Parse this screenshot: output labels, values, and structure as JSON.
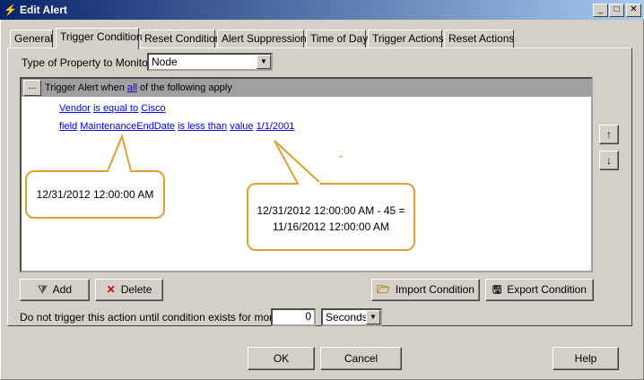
{
  "window": {
    "title": "Edit Alert",
    "min_glyph": "_",
    "max_glyph": "□",
    "close_glyph": "✕"
  },
  "tabs": [
    {
      "label": "General"
    },
    {
      "label": "Trigger Condition"
    },
    {
      "label": "Reset Condition"
    },
    {
      "label": "Alert Suppression"
    },
    {
      "label": "Time of Day"
    },
    {
      "label": "Trigger Actions"
    },
    {
      "label": "Reset Actions"
    }
  ],
  "active_tab": "Trigger Condition",
  "property": {
    "label": "Type of Property to Monitor:",
    "value": "Node"
  },
  "condition": {
    "ellipsis": "...",
    "header_pre": "Trigger Alert when ",
    "header_link": "all",
    "header_post": " of the following apply",
    "line1": {
      "a": "Vendor",
      "b": "is equal to",
      "c": "Cisco"
    },
    "line2": {
      "a": "field",
      "b": "MaintenanceEndDate",
      "c": "is less than",
      "d": "value",
      "e": "1/1/2001"
    },
    "stray_mark": "-"
  },
  "callouts": {
    "left": "12/31/2012 12:00:00 AM",
    "right_line1": "12/31/2012 12:00:00 AM - 45 =",
    "right_line2": "11/16/2012 12:00:00 AM"
  },
  "buttons": {
    "add": "Add",
    "delete": "Delete",
    "import": "Import Condition",
    "export": "Export Condition",
    "ok": "OK",
    "cancel": "Cancel",
    "help": "Help",
    "move_up": "↑",
    "move_down": "↓"
  },
  "trigger_delay": {
    "label": "Do not trigger this action until condition exists for more than",
    "value": "0",
    "unit": "Seconds"
  },
  "colors": {
    "accent_callout": "#e0a030",
    "link": "#0000ee",
    "titlebar_start": "#0a246a"
  }
}
